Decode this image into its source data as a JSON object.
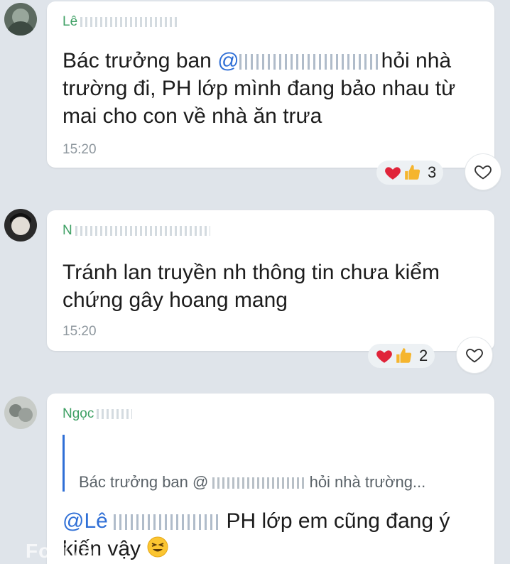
{
  "messages": [
    {
      "sender": "Lê",
      "text_mention": "@",
      "text_after_mention": "hỏi nhà",
      "text_prefix": "Bác trưởng ban ",
      "text_line2": "trường đi, PH lớp mình đang bảo nhau từ",
      "text_line3": "mai cho con về nhà ăn trưa",
      "time": "15:20",
      "reaction_count": "3"
    },
    {
      "sender": "N",
      "text_line1": "Tránh lan truyền nh thông tin chưa kiểm",
      "text_line2": "chứng gây hoang mang",
      "time": "15:20",
      "reaction_count": "2"
    },
    {
      "sender": "Ngọc",
      "quote_prefix": "Bác trưởng ban @ ",
      "quote_suffix": " hỏi nhà trường...",
      "reply_mention": "@Lê",
      "reply_line1_rest": " PH lớp em cũng đang ý",
      "reply_line2": "kiến vậy"
    }
  ],
  "watermark": "Fovivo",
  "colors": {
    "sender_name": "#3ea064",
    "mention": "#2f6fd6",
    "background": "#dfe4ea",
    "heart": "#e0243a",
    "thumb": "#f5b52e"
  },
  "icons": {
    "reaction_heart": "heart-icon",
    "reaction_thumb": "thumbs-up-icon",
    "like_button": "heart-outline-icon",
    "emoji": "grinning-squint-face-icon"
  }
}
